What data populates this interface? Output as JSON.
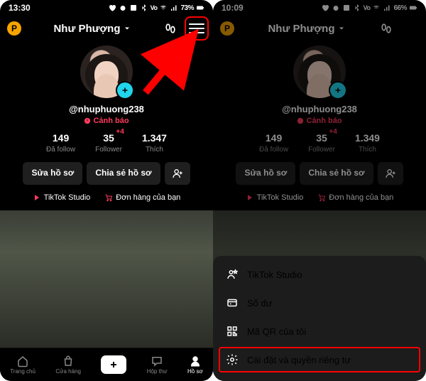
{
  "left": {
    "status": {
      "time": "13:30",
      "battery": "73%"
    },
    "p_badge": "P",
    "title": "Như Phượng",
    "username": "@nhuphuong238",
    "warning": "Cảnh báo",
    "stats": [
      {
        "num": "149",
        "label": "Đã follow"
      },
      {
        "num": "35",
        "sup": "+4",
        "label": "Follower"
      },
      {
        "num": "1.347",
        "label": "Thích"
      }
    ],
    "btn_edit": "Sửa hồ sơ",
    "btn_share": "Chia sẻ hồ sơ",
    "link_studio": "TikTok Studio",
    "link_orders": "Đơn hàng của bạn",
    "nav": {
      "home": "Trang chủ",
      "shop": "Cửa hàng",
      "inbox": "Hộp thư",
      "profile": "Hồ sơ"
    }
  },
  "right": {
    "status": {
      "time": "10:09",
      "battery": "66%"
    },
    "p_badge": "P",
    "title": "Như Phượng",
    "username": "@nhuphuong238",
    "warning": "Cảnh báo",
    "stats": [
      {
        "num": "149",
        "label": "Đã follow"
      },
      {
        "num": "35",
        "sup": "+4",
        "label": "Follower"
      },
      {
        "num": "1.349",
        "label": "Thích"
      }
    ],
    "btn_edit": "Sửa hồ sơ",
    "btn_share": "Chia sẻ hồ sơ",
    "link_studio": "TikTok Studio",
    "link_orders": "Đơn hàng của bạn",
    "sheet": {
      "studio": "TikTok Studio",
      "balance": "Số dư",
      "qr": "Mã QR của tôi",
      "settings": "Cài đặt và quyền riêng tư"
    }
  }
}
